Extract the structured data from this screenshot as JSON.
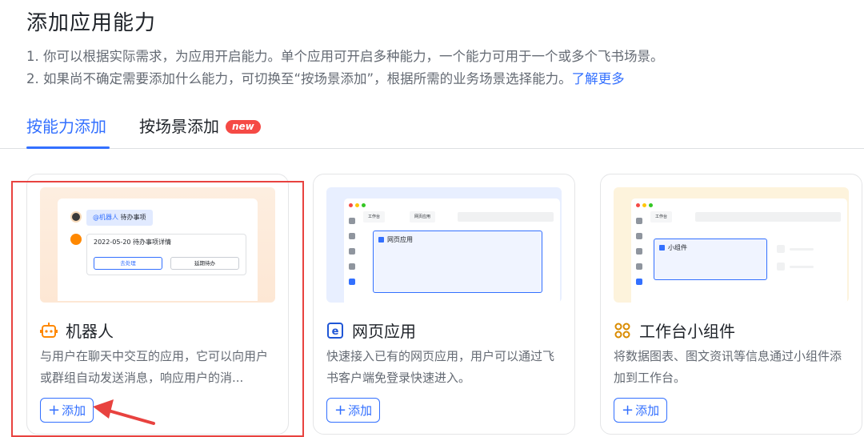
{
  "page": {
    "title": "添加应用能力",
    "desc_line1": "1. 你可以根据实际需求，为应用开启能力。单个应用可开启多种能力，一个能力可用于一个或多个飞书场景。",
    "desc_line2_prefix": "2. 如果尚不确定需要添加什么能力，可切换至“按场景添加”，根据所需的业务场景选择能力。",
    "learn_more": "了解更多"
  },
  "tabs": [
    {
      "label": "按能力添加",
      "active": true
    },
    {
      "label": "按场景添加",
      "badge": "new",
      "active": false
    }
  ],
  "cards": [
    {
      "title": "机器人",
      "icon": "robot-icon",
      "description": "与用户在聊天中交互的应用，它可以向用户或群组自动发送消息，响应用户的消...",
      "add_label": "添加",
      "preview": {
        "mention": "@机器人",
        "mention_text": "待办事项",
        "card_title": "2022-05-20 待办事项详情",
        "button_primary": "去处理",
        "button_secondary": "延期待办"
      }
    },
    {
      "title": "网页应用",
      "icon": "web-app-icon",
      "description": "快速接入已有的网页应用，用户可以通过飞书客户端免登录快速进入。",
      "add_label": "添加",
      "preview": {
        "tab1": "工作台",
        "tab2": "网页应用",
        "box_label": "网页应用"
      }
    },
    {
      "title": "工作台小组件",
      "icon": "widget-icon",
      "description": "将数据图表、图文资讯等信息通过小组件添加到工作台。",
      "add_label": "添加",
      "preview": {
        "tab1": "工作台",
        "box_label": "小组件"
      }
    }
  ],
  "colors": {
    "accent": "#3370ff",
    "highlight": "#e8423f",
    "badge": "#f54a45"
  }
}
